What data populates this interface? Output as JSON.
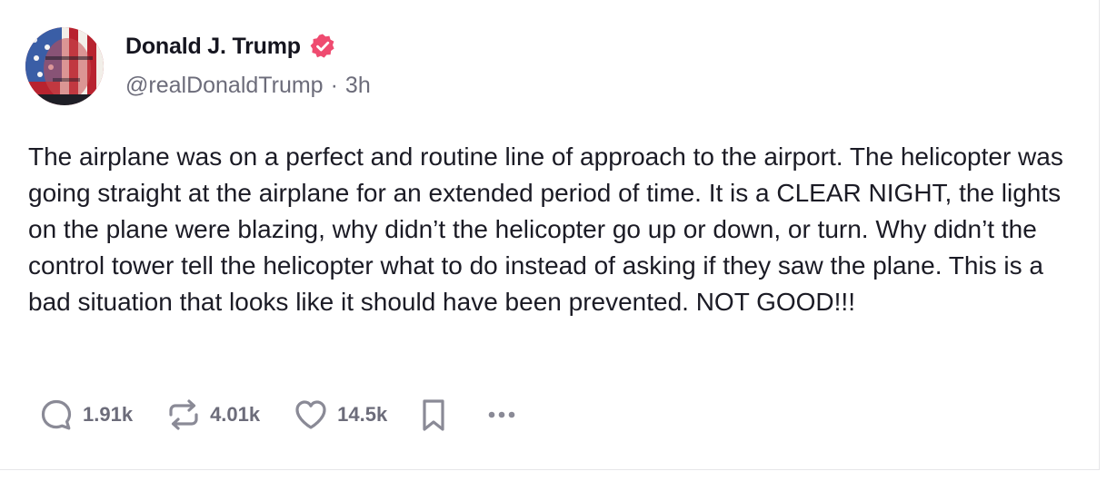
{
  "author": {
    "display_name": "Donald J. Trump",
    "handle": "@realDonaldTrump",
    "separator": "·",
    "time_ago": "3h",
    "verified_color": "#ef4b70"
  },
  "post": {
    "text": "The airplane was on a perfect and routine line of approach to the airport. The helicopter was going straight at the airplane for an extended period of time. It is a CLEAR NIGHT, the lights on the plane were blazing, why didn’t the helicopter go up or down, or turn. Why didn’t the control tower tell the helicopter what to do instead of asking if they saw the plane. This is a bad situation that looks like it should have been prevented. NOT GOOD!!!"
  },
  "actions": {
    "replies": "1.91k",
    "reposts": "4.01k",
    "likes": "14.5k",
    "icons": [
      "reply-icon",
      "repost-icon",
      "heart-icon",
      "bookmark-icon",
      "more-icon"
    ]
  },
  "colors": {
    "text": "#1b1b25",
    "muted": "#6c6c7a",
    "icon": "#8a8a96"
  }
}
